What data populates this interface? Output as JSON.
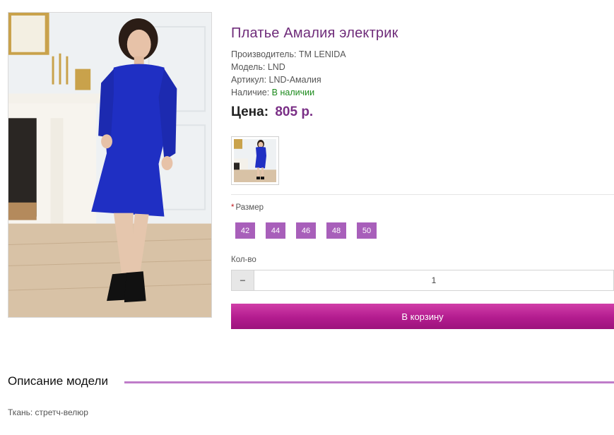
{
  "product": {
    "title": "Платье Амалия электрик",
    "manufacturer": "Производитель: TM LENIDA",
    "model": "Модель: LND",
    "sku": "Артикул: LND-Амалия",
    "availability_label": "Наличие:",
    "availability_value": "В наличии",
    "price_label": "Цена:",
    "price_value": "805 р."
  },
  "images": {
    "main_alt": "dress-photo",
    "thumb_alt": "dress-thumbnail"
  },
  "options": {
    "size_required_mark": "*",
    "size_label": "Размер",
    "sizes": [
      "42",
      "44",
      "46",
      "48",
      "50"
    ]
  },
  "quantity": {
    "label": "Кол-во",
    "minus_symbol": "−",
    "value": "1"
  },
  "cart": {
    "button_label": "В корзину"
  },
  "description": {
    "title": "Описание модели",
    "text": "Ткань: стретч-велюр"
  },
  "colors": {
    "title": "#6f2c7a",
    "price": "#7a2f86",
    "size_button": "#a85fba",
    "cart_button": "#b31c8f",
    "in_stock": "#1b8a1b",
    "desc_line": "#bf7cc9"
  }
}
